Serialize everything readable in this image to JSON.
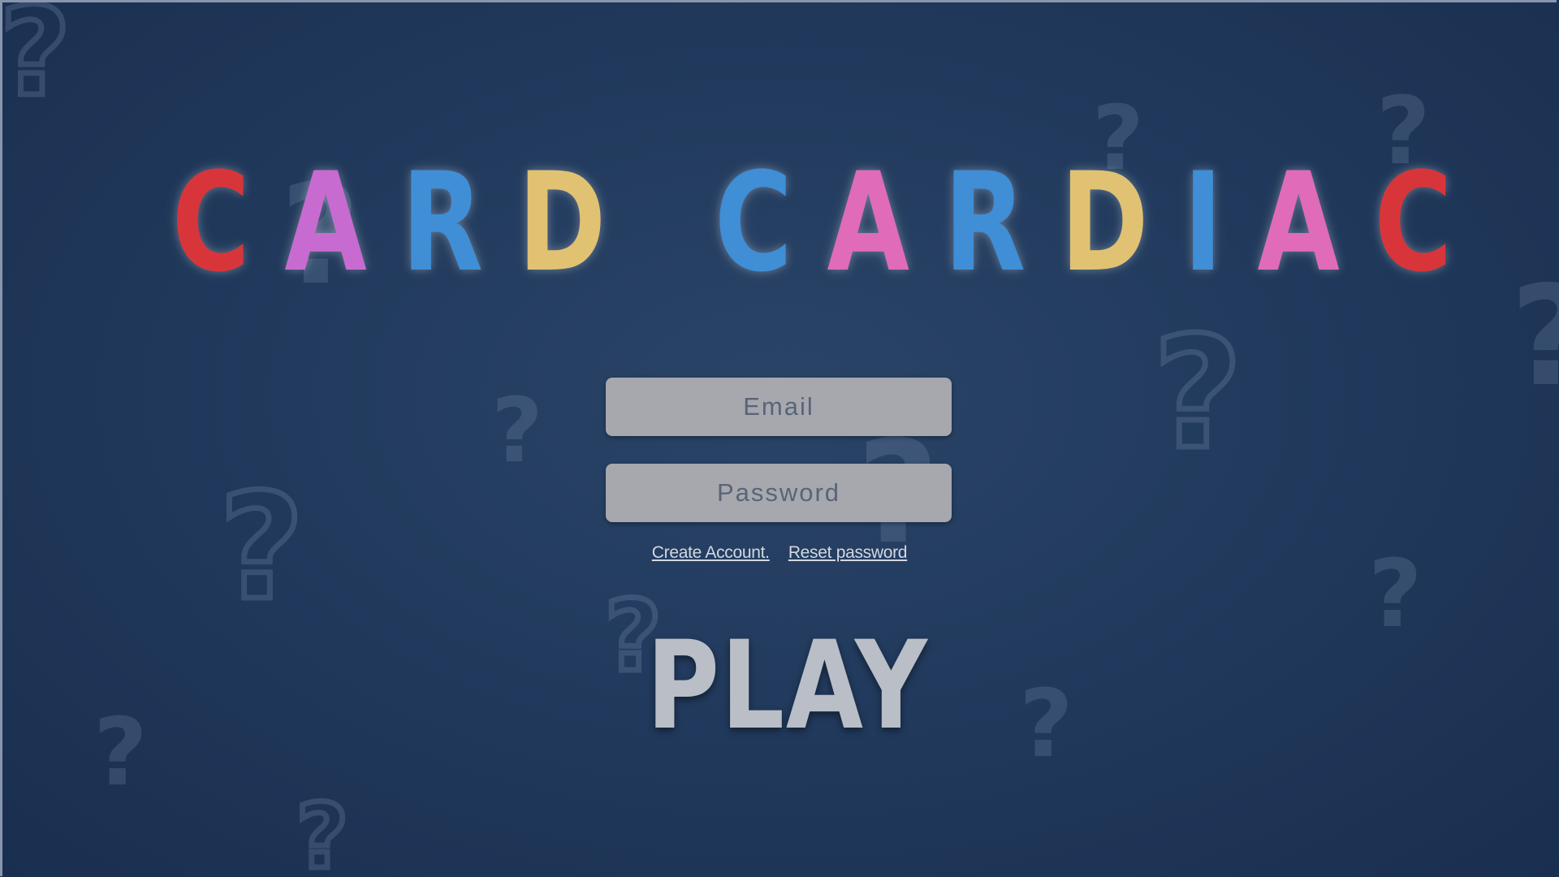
{
  "title": {
    "letters": [
      {
        "char": "C",
        "color": "#d8353a"
      },
      {
        "char": "A",
        "color": "#c86bd0"
      },
      {
        "char": "R",
        "color": "#3f8ed6"
      },
      {
        "char": "D",
        "color": "#e0c272"
      },
      {
        "char": "C",
        "color": "#3f8ed6"
      },
      {
        "char": "A",
        "color": "#e06bb8"
      },
      {
        "char": "R",
        "color": "#3f8ed6"
      },
      {
        "char": "D",
        "color": "#e0c272"
      },
      {
        "char": "I",
        "color": "#3f8ed6"
      },
      {
        "char": "A",
        "color": "#e06bb8"
      },
      {
        "char": "C",
        "color": "#d8353a"
      }
    ]
  },
  "login": {
    "email_placeholder": "Email",
    "password_placeholder": "Password",
    "create_account_label": "Create Account.",
    "reset_password_label": "Reset password"
  },
  "play_label": "PLAY",
  "background": {
    "decoration_glyph": "?",
    "color": "#213a5d"
  }
}
